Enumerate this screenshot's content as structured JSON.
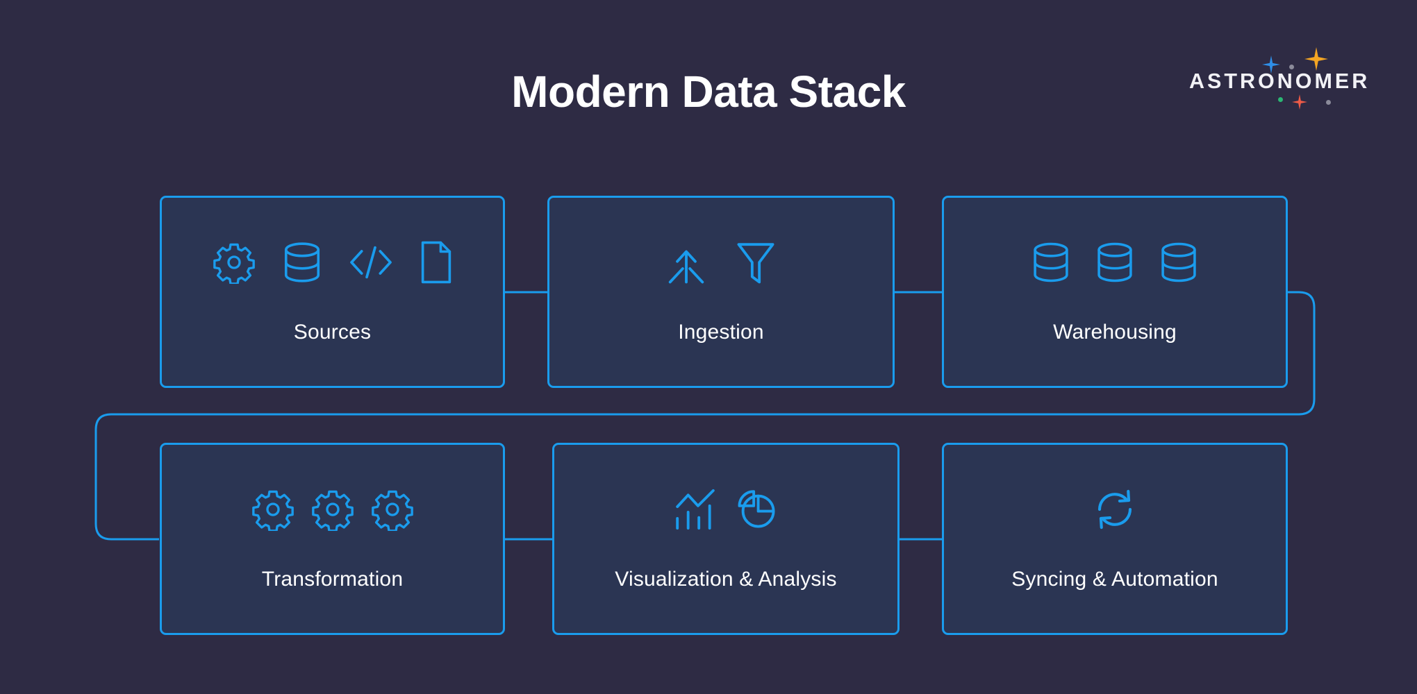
{
  "page": {
    "title": "Modern Data Stack",
    "background_color": "#2e2b44",
    "card_fill_color": "#2b3553",
    "accent_color": "#1a9ced",
    "text_color": "#ffffff"
  },
  "logo": {
    "wordmark": "ASTRONOMER",
    "sparkles": [
      {
        "name": "blue-star",
        "color": "#2f8fe8"
      },
      {
        "name": "orange-star",
        "color": "#f5a623"
      },
      {
        "name": "red-star",
        "color": "#ef5b47"
      },
      {
        "name": "grey-dot-1",
        "color": "#8b8b9a"
      },
      {
        "name": "grey-dot-2",
        "color": "#8b8b9a"
      },
      {
        "name": "green-dot",
        "color": "#2bb673"
      }
    ]
  },
  "diagram": {
    "type": "flow",
    "flow_order": [
      "Sources",
      "Ingestion",
      "Warehousing",
      "Transformation",
      "Visualization & Analysis",
      "Syncing & Automation"
    ],
    "connections": [
      {
        "from": "Sources",
        "to": "Ingestion",
        "style": "straight"
      },
      {
        "from": "Ingestion",
        "to": "Warehousing",
        "style": "straight"
      },
      {
        "from": "Warehousing",
        "to": "Transformation",
        "style": "wrap-around"
      },
      {
        "from": "Transformation",
        "to": "Visualization & Analysis",
        "style": "straight"
      },
      {
        "from": "Visualization & Analysis",
        "to": "Syncing & Automation",
        "style": "straight"
      }
    ],
    "cards": [
      {
        "id": "sources",
        "label": "Sources",
        "row": 1,
        "icons": [
          "gear-icon",
          "database-icon",
          "code-brackets-icon",
          "document-icon"
        ]
      },
      {
        "id": "ingestion",
        "label": "Ingestion",
        "row": 1,
        "icons": [
          "merge-arrow-icon",
          "funnel-filter-icon"
        ]
      },
      {
        "id": "warehousing",
        "label": "Warehousing",
        "row": 1,
        "icons": [
          "database-icon",
          "database-icon",
          "database-icon"
        ]
      },
      {
        "id": "transformation",
        "label": "Transformation",
        "row": 2,
        "icons": [
          "gear-icon",
          "gear-icon",
          "gear-icon"
        ]
      },
      {
        "id": "visualization",
        "label": "Visualization & Analysis",
        "row": 2,
        "icons": [
          "bar-chart-trend-icon",
          "pie-chart-icon"
        ]
      },
      {
        "id": "syncing",
        "label": "Syncing & Automation",
        "row": 2,
        "icons": [
          "sync-refresh-icon"
        ]
      }
    ]
  }
}
